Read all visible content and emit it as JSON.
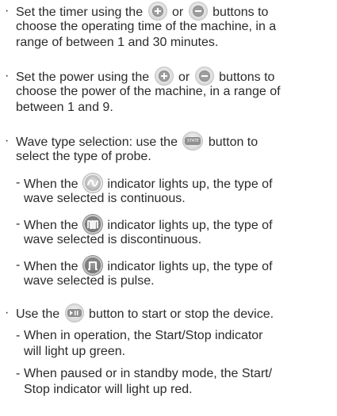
{
  "bullet_char": "·",
  "dash_char": "-",
  "icons": {
    "plus": "plus-button-icon",
    "minus": "minus-button-icon",
    "state": "state-button-icon",
    "continuous": "continuous-wave-indicator-icon",
    "discontinuous": "discontinuous-wave-indicator-icon",
    "pulse": "pulse-wave-indicator-icon",
    "play_pause": "play-pause-button-icon",
    "state_label": "STATE"
  },
  "timer": {
    "line1_a": "Set the timer using the",
    "line1_b": "or",
    "line1_c": "buttons to",
    "line2": "choose the operating time of the machine, in a",
    "line3": "range of between 1 and 30 minutes."
  },
  "power": {
    "line1_a": "Set the power using the",
    "line1_b": "or",
    "line1_c": "buttons to",
    "line2": "choose the power of the machine, in a range of",
    "line3": "between 1 and 9."
  },
  "wave": {
    "line1_a": "Wave type selection: use the",
    "line1_b": "button to",
    "line2": "select the type of probe.",
    "continuous_1a": "When the",
    "continuous_1b": "indicator lights up, the type of",
    "continuous_2": "wave selected is continuous.",
    "discontinuous_1a": "When the",
    "discontinuous_1b": "indicator lights up, the type of",
    "discontinuous_2": "wave selected is discontinuous.",
    "pulse_1a": "When the",
    "pulse_1b": "indicator lights up, the type of",
    "pulse_2": "wave selected is pulse."
  },
  "startstop": {
    "line1_a": "Use the",
    "line1_b": "button to start or stop the device.",
    "operation_1": "When in operation, the Start/Stop indicator",
    "operation_2": "will light up green.",
    "paused_1": "When paused or in standby mode, the Start/",
    "paused_2": "Stop indicator will light up red."
  }
}
